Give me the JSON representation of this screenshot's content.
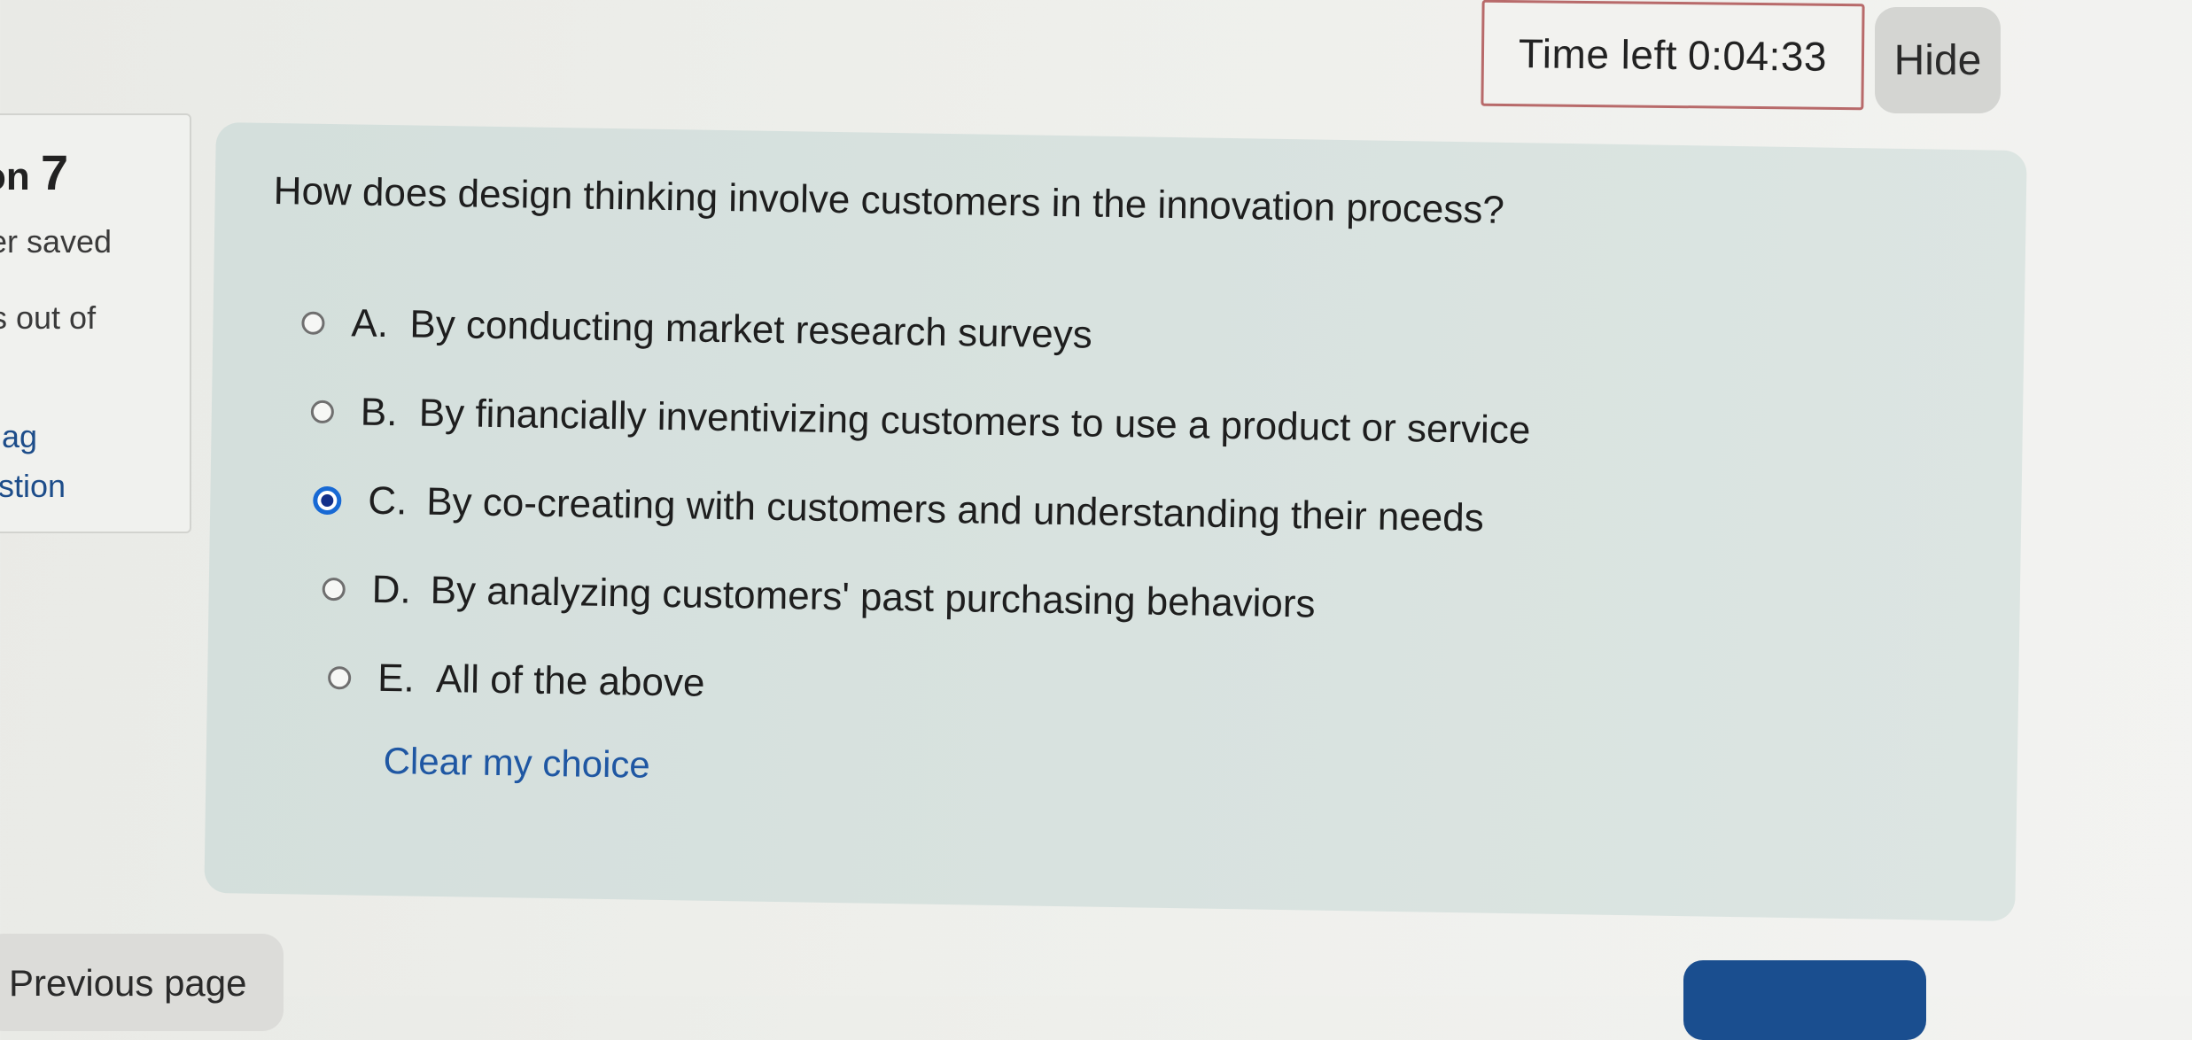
{
  "timer": {
    "label": "Time left",
    "value": "0:04:33",
    "hide_label": "Hide"
  },
  "question_info": {
    "number_prefix": "on",
    "number": "7",
    "status": "er saved",
    "marks": "s out of",
    "flag_line1": "ag",
    "flag_line2": "stion"
  },
  "question": {
    "text": "How does design thinking involve customers in the innovation process?",
    "selected": "C",
    "answers": [
      {
        "letter": "A.",
        "text": "By conducting market research surveys"
      },
      {
        "letter": "B.",
        "text": "By financially inventivizing customers to use a product or service"
      },
      {
        "letter": "C.",
        "text": "By co-creating with customers and understanding their needs"
      },
      {
        "letter": "D.",
        "text": "By analyzing customers' past purchasing behaviors"
      },
      {
        "letter": "E.",
        "text": "All of the above"
      }
    ],
    "clear_label": "Clear my choice"
  },
  "navigation": {
    "previous_label": "Previous page"
  },
  "colors": {
    "accent": "#1769d4",
    "link": "#1f57a3",
    "next_button": "#1a4e8f",
    "timer_border": "#b86a6a",
    "card_background": "#d8e2df"
  }
}
